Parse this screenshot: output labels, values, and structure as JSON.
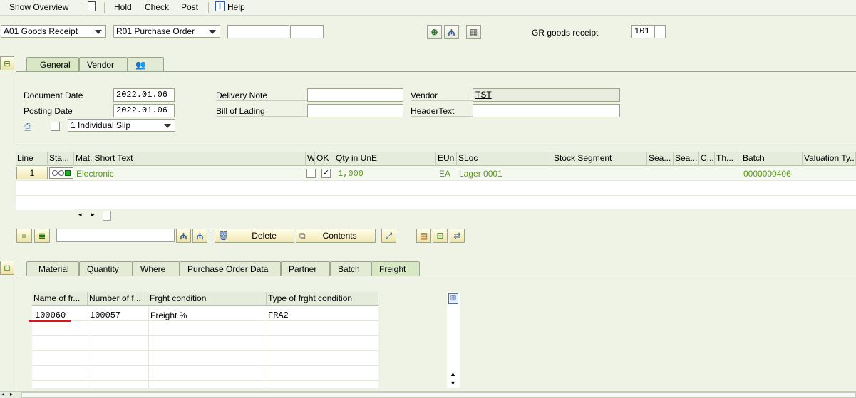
{
  "menu": {
    "show_overview": "Show Overview",
    "hold": "Hold",
    "check": "Check",
    "post": "Post",
    "help": "Help"
  },
  "toolbar": {
    "action_select": "A01 Goods Receipt",
    "reference_select": "R01 Purchase Order",
    "ref_doc_input": "",
    "ref_item_input": "",
    "mvt_label": "GR goods receipt",
    "mvt_type": "101",
    "mvt_extra": ""
  },
  "header_tabs": [
    {
      "label": "General"
    },
    {
      "label": "Vendor"
    }
  ],
  "general": {
    "document_date_label": "Document Date",
    "document_date": "2022.01.06",
    "posting_date_label": "Posting Date",
    "posting_date": "2022.01.06",
    "delivery_note_label": "Delivery Note",
    "delivery_note": "",
    "bill_of_lading_label": "Bill of Lading",
    "bill_of_lading": "",
    "vendor_label": "Vendor",
    "vendor": "TST",
    "header_text_label": "HeaderText",
    "header_text": "",
    "slip_select": "1 Individual Slip"
  },
  "item_grid": {
    "columns": [
      "Line",
      "Sta...",
      "Mat. Short Text",
      "W",
      "OK",
      "Qty in UnE",
      "EUn",
      "SLoc",
      "Stock Segment",
      "Sea...",
      "Sea...",
      "C...",
      "Th...",
      "Batch",
      "Valuation Ty..."
    ],
    "rows": [
      {
        "line": "1",
        "mat_short_text": "Electronic",
        "ok": "✓",
        "qty": "1,000",
        "eun": "EA",
        "sloc": "Lager 0001",
        "batch": "0000000406"
      }
    ]
  },
  "item_toolbar": {
    "search_input": "",
    "delete_label": "Delete",
    "contents_label": "Contents"
  },
  "detail_tabs": [
    {
      "label": "Material"
    },
    {
      "label": "Quantity"
    },
    {
      "label": "Where"
    },
    {
      "label": "Purchase Order Data"
    },
    {
      "label": "Partner"
    },
    {
      "label": "Batch"
    },
    {
      "label": "Freight"
    }
  ],
  "freight_grid": {
    "columns": [
      "Name of fr...",
      "Number of f...",
      "Frght condition",
      "Type of frght condition"
    ],
    "rows": [
      {
        "name": "100060",
        "number": "100057",
        "condition": "Freight %",
        "type": "FRA2"
      }
    ]
  },
  "colors": {
    "background": "#eef3e6",
    "accent_green": "#5a9a1c",
    "annotation_red": "#e0141e"
  }
}
